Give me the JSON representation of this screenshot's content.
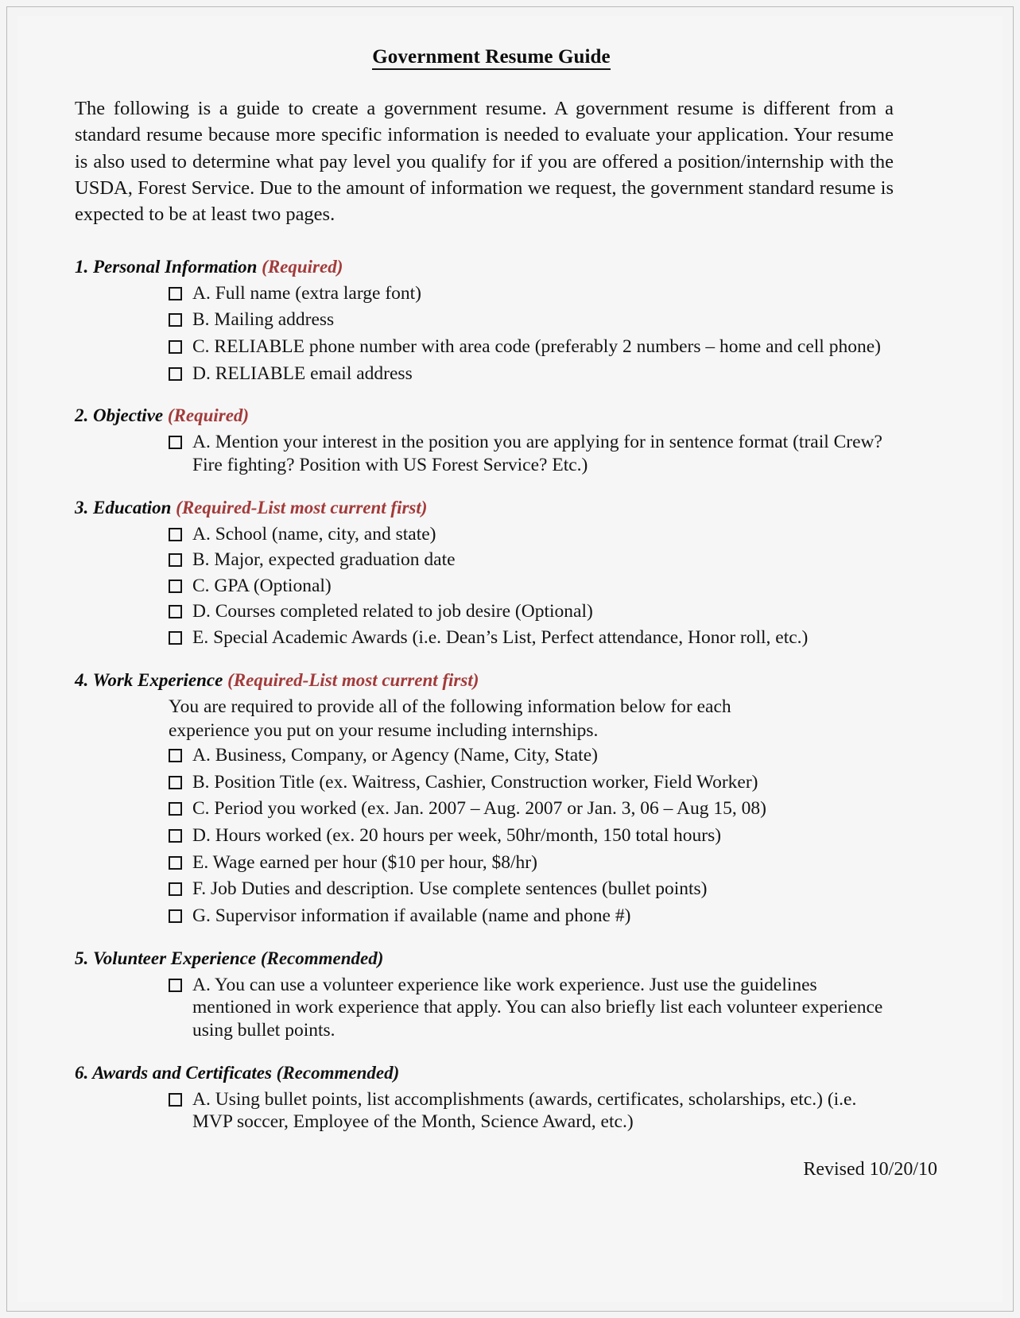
{
  "document": {
    "title": "Government Resume Guide",
    "intro": "The following is a guide to create a government resume. A government resume is different from a standard resume because more specific information is needed to evaluate your application. Your resume is also used to determine what pay level you qualify for if you are offered a position/internship with the USDA, Forest Service. Due to the amount of information we request, the government standard resume is expected to be at least two pages.",
    "revised": "Revised 10/20/10"
  },
  "sections": [
    {
      "number": "1.",
      "heading": "Personal Information",
      "qualifier": "(Required)",
      "qualifier_color": "#a33a3a",
      "note": "",
      "items": [
        {
          "label": "A. Full name (extra large font)",
          "continuation": ""
        },
        {
          "label": "B. Mailing address",
          "continuation": ""
        },
        {
          "label": "C. RELIABLE phone number with area code (preferably 2 numbers – home and cell phone)",
          "continuation": ""
        },
        {
          "label": "D. RELIABLE email address",
          "continuation": ""
        }
      ]
    },
    {
      "number": "2.",
      "heading": "Objective",
      "qualifier": "(Required)",
      "qualifier_color": "#a33a3a",
      "note": "",
      "items": [
        {
          "label": "A. Mention your interest in the position you are applying for in sentence format (trail Crew?",
          "continuation": "Fire fighting? Position with US Forest Service? Etc.)"
        }
      ]
    },
    {
      "number": "3.",
      "heading": "Education",
      "qualifier": "(Required-List most current first)",
      "qualifier_color": "#a33a3a",
      "note": "",
      "items": [
        {
          "label": "A. School (name, city, and state)",
          "continuation": ""
        },
        {
          "label": "B. Major, expected graduation date",
          "continuation": ""
        },
        {
          "label": "C. GPA (Optional)",
          "continuation": ""
        },
        {
          "label": "D. Courses completed related to job desire (Optional)",
          "continuation": ""
        },
        {
          "label": "E. Special Academic Awards (i.e. Dean’s List, Perfect attendance, Honor roll, etc.)",
          "continuation": ""
        }
      ]
    },
    {
      "number": "4.",
      "heading": "Work Experience",
      "qualifier": "(Required-List most current first)",
      "qualifier_color": "#a33a3a",
      "note_line1": "You are required to provide all of the following information below for each",
      "note_line2": "experience you put on your resume including internships.",
      "items": [
        {
          "label": "A. Business, Company, or Agency (Name, City, State)",
          "continuation": ""
        },
        {
          "label": "B. Position Title (ex. Waitress, Cashier, Construction worker, Field Worker)",
          "continuation": ""
        },
        {
          "label": "C. Period you worked (ex. Jan. 2007 – Aug. 2007 or Jan. 3, 06 – Aug 15, 08)",
          "continuation": ""
        },
        {
          "label": "D. Hours worked (ex. 20 hours per week, 50hr/month, 150 total hours)",
          "continuation": ""
        },
        {
          "label": "E. Wage earned per hour ($10 per hour, $8/hr)",
          "continuation": ""
        },
        {
          "label": "F. Job Duties and description. Use complete sentences (bullet points)",
          "continuation": ""
        },
        {
          "label": "G. Supervisor information if available (name and phone #)",
          "continuation": ""
        }
      ]
    },
    {
      "number": "5.",
      "heading": "Volunteer Experience",
      "qualifier": "(Recommended)",
      "qualifier_color": "#141414",
      "note": "",
      "items": [
        {
          "label": "A. You can use a volunteer experience like work experience. Just use the guidelines",
          "continuation": "mentioned in work experience that apply. You can also briefly list each volunteer experience",
          "continuation2": "using bullet points."
        }
      ]
    },
    {
      "number": "6.",
      "heading": "Awards and Certificates",
      "qualifier": "(Recommended)",
      "qualifier_color": "#141414",
      "note": "",
      "items": [
        {
          "label": "A. Using bullet points, list accomplishments (awards, certificates, scholarships, etc.) (i.e.",
          "continuation": "MVP soccer, Employee of the Month, Science Award, etc.)"
        }
      ]
    }
  ]
}
